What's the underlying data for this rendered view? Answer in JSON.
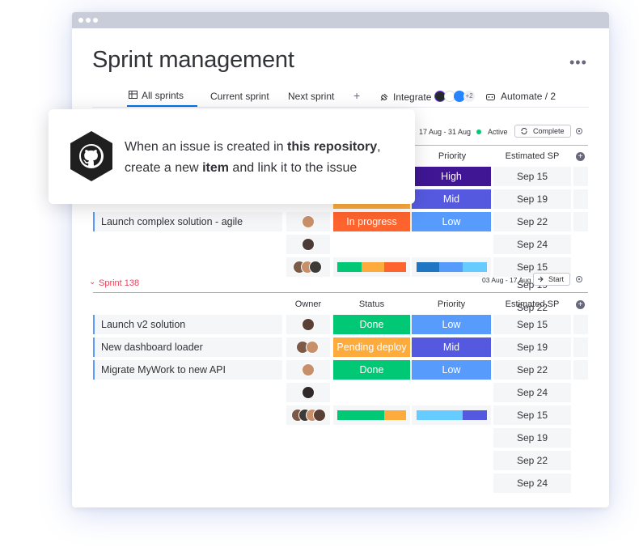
{
  "page": {
    "title": "Sprint management",
    "more": "•••"
  },
  "tabs": {
    "all": "All sprints",
    "current": "Current sprint",
    "next": "Next sprint",
    "add": "+",
    "integrate": "Integrate",
    "integrate_count": "+2",
    "automate": "Automate / 2"
  },
  "sprint_active": {
    "dates": "17 Aug - 31 Aug",
    "status": "Active",
    "action": "Complete",
    "columns": {
      "priority": "Priority",
      "estimated": "Estimated SP"
    },
    "rows": [
      {
        "name": "",
        "status": "",
        "priority": "High",
        "sp": "Sep 15"
      },
      {
        "name": "",
        "status": "",
        "priority": "Mid",
        "sp": "Sep 19"
      },
      {
        "name": "Launch complex solution - agile",
        "status": "In progress",
        "priority": "Low",
        "sp": "Sep 22"
      }
    ],
    "extra_sp": [
      "Sep 24",
      "Sep 15",
      "Sep 19",
      "Sep 22"
    ]
  },
  "sprint_138": {
    "title": "Sprint 138",
    "dates": "03 Aug - 17 Aug",
    "action": "Start",
    "columns": {
      "owner": "Owner",
      "status": "Status",
      "priority": "Priority",
      "estimated": "Estimated SP"
    },
    "rows": [
      {
        "name": "Launch v2 solution",
        "status": "Done",
        "priority": "Low",
        "sp": "Sep 15"
      },
      {
        "name": "New dashboard loader",
        "status": "Pending deploy",
        "priority": "Mid",
        "sp": "Sep 19"
      },
      {
        "name": "Migrate MyWork to new API",
        "status": "Done",
        "priority": "Low",
        "sp": "Sep 22"
      }
    ],
    "extra_sp": [
      "Sep 24",
      "Sep 15",
      "Sep 19",
      "Sep 22",
      "Sep 24"
    ]
  },
  "popup": {
    "t1": "When an issue is created in ",
    "b1": "this repository",
    "t2": ",",
    "t3": "create a new ",
    "b2": "item",
    "t4": " and link it to the issue"
  },
  "colors": {
    "high": "#401694",
    "mid": "#5559df",
    "low": "#579bfc",
    "in_progress": "#ff642e",
    "done": "#00c875",
    "pending": "#fdab3d",
    "active_dot": "#00c875",
    "sprint_group": "#e2445c",
    "accent": "#0073ea"
  },
  "icons": [
    "table-icon",
    "plug-icon",
    "robot-icon",
    "github-icon",
    "settings-icon",
    "add-column-icon",
    "play-icon",
    "refresh-icon"
  ]
}
